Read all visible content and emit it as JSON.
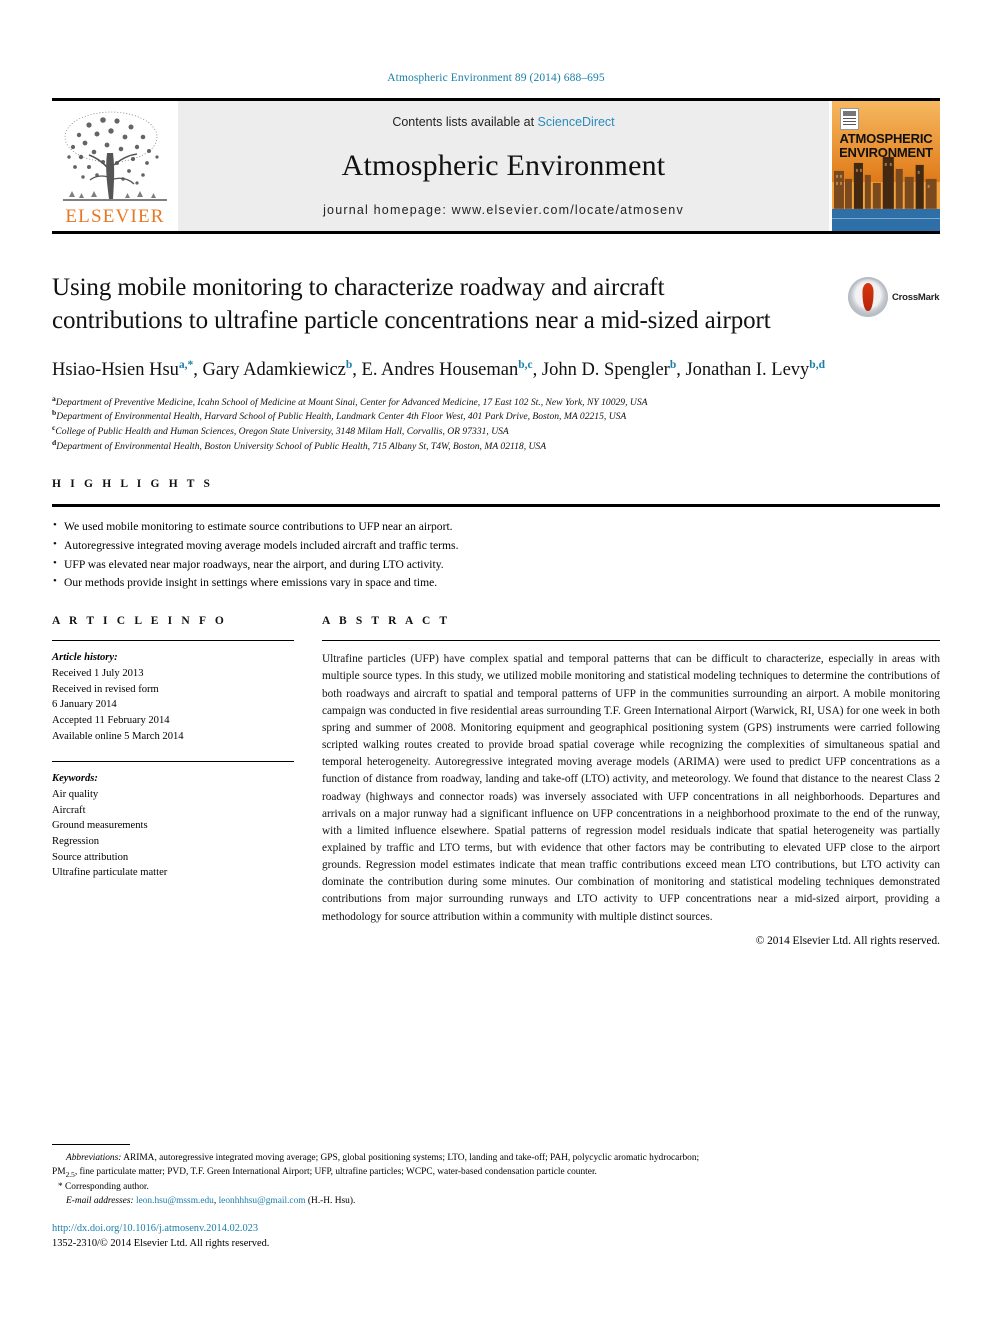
{
  "running_head": "Atmospheric Environment 89 (2014) 688–695",
  "masthead": {
    "publisher_name": "ELSEVIER",
    "contents_prefix": "Contents lists available at ",
    "contents_link": "ScienceDirect",
    "journal_title": "Atmospheric Environment",
    "homepage": "journal homepage: www.elsevier.com/locate/atmosenv",
    "cover_line1": "ATMOSPHERIC",
    "cover_line2": "ENVIRONMENT"
  },
  "article": {
    "title": "Using mobile monitoring to characterize roadway and aircraft contributions to ultrafine particle concentrations near a mid-sized airport",
    "crossmark_label": "CrossMark",
    "authors": [
      {
        "name": "Hsiao-Hsien Hsu",
        "marks": "a,*"
      },
      {
        "name": "Gary Adamkiewicz",
        "marks": "b"
      },
      {
        "name": "E. Andres Houseman",
        "marks": "b,c"
      },
      {
        "name": "John D. Spengler",
        "marks": "b"
      },
      {
        "name": "Jonathan I. Levy",
        "marks": "b,d"
      }
    ],
    "affiliations": [
      {
        "mark": "a",
        "text": "Department of Preventive Medicine, Icahn School of Medicine at Mount Sinai, Center for Advanced Medicine, 17 East 102 St., New York, NY 10029, USA"
      },
      {
        "mark": "b",
        "text": "Department of Environmental Health, Harvard School of Public Health, Landmark Center 4th Floor West, 401 Park Drive, Boston, MA 02215, USA"
      },
      {
        "mark": "c",
        "text": "College of Public Health and Human Sciences, Oregon State University, 3148 Milam Hall, Corvallis, OR 97331, USA"
      },
      {
        "mark": "d",
        "text": "Department of Environmental Health, Boston University School of Public Health, 715 Albany St, T4W, Boston, MA 02118, USA"
      }
    ]
  },
  "highlights": {
    "heading": "H I G H L I G H T S",
    "items": [
      "We used mobile monitoring to estimate source contributions to UFP near an airport.",
      "Autoregressive integrated moving average models included aircraft and traffic terms.",
      "UFP was elevated near major roadways, near the airport, and during LTO activity.",
      "Our methods provide insight in settings where emissions vary in space and time."
    ]
  },
  "article_info": {
    "heading": "A R T I C L E  I N F O",
    "history_label": "Article history:",
    "history": [
      "Received 1 July 2013",
      "Received in revised form",
      "6 January 2014",
      "Accepted 11 February 2014",
      "Available online 5 March 2014"
    ],
    "keywords_label": "Keywords:",
    "keywords": [
      "Air quality",
      "Aircraft",
      "Ground measurements",
      "Regression",
      "Source attribution",
      "Ultrafine particulate matter"
    ]
  },
  "abstract": {
    "heading": "A B S T R A C T",
    "text": "Ultrafine particles (UFP) have complex spatial and temporal patterns that can be difficult to characterize, especially in areas with multiple source types. In this study, we utilized mobile monitoring and statistical modeling techniques to determine the contributions of both roadways and aircraft to spatial and temporal patterns of UFP in the communities surrounding an airport. A mobile monitoring campaign was conducted in five residential areas surrounding T.F. Green International Airport (Warwick, RI, USA) for one week in both spring and summer of 2008. Monitoring equipment and geographical positioning system (GPS) instruments were carried following scripted walking routes created to provide broad spatial coverage while recognizing the complexities of simultaneous spatial and temporal heterogeneity. Autoregressive integrated moving average models (ARIMA) were used to predict UFP concentrations as a function of distance from roadway, landing and take-off (LTO) activity, and meteorology. We found that distance to the nearest Class 2 roadway (highways and connector roads) was inversely associated with UFP concentrations in all neighborhoods. Departures and arrivals on a major runway had a significant influence on UFP concentrations in a neighborhood proximate to the end of the runway, with a limited influence elsewhere. Spatial patterns of regression model residuals indicate that spatial heterogeneity was partially explained by traffic and LTO terms, but with evidence that other factors may be contributing to elevated UFP close to the airport grounds. Regression model estimates indicate that mean traffic contributions exceed mean LTO contributions, but LTO activity can dominate the contribution during some minutes. Our combination of monitoring and statistical modeling techniques demonstrated contributions from major surrounding runways and LTO activity to UFP concentrations near a mid-sized airport, providing a methodology for source attribution within a community with multiple distinct sources.",
    "copyright": "© 2014 Elsevier Ltd. All rights reserved."
  },
  "footnotes": {
    "abbreviations_label": "Abbreviations:",
    "abbreviations_text_1": " ARIMA, autoregressive integrated moving average; GPS, global positioning systems; LTO, landing and take-off; PAH, polycyclic aromatic hydrocarbon;",
    "abbreviations_text_2a": "PM",
    "abbreviations_text_2b": "2.5",
    "abbreviations_text_2c": ", fine particulate matter; PVD, T.F. Green International Airport; UFP, ultrafine particles; WCPC, water-based condensation particle counter.",
    "corresponding": "* Corresponding author.",
    "email_label": "E-mail addresses:",
    "email_1": "leon.hsu@mssm.edu",
    "email_sep": ", ",
    "email_2": "leonhhhsu@gmail.com",
    "email_suffix": " (H.-H. Hsu).",
    "doi": "http://dx.doi.org/10.1016/j.atmosenv.2014.02.023",
    "issn_line": "1352-2310/© 2014 Elsevier Ltd. All rights reserved."
  }
}
